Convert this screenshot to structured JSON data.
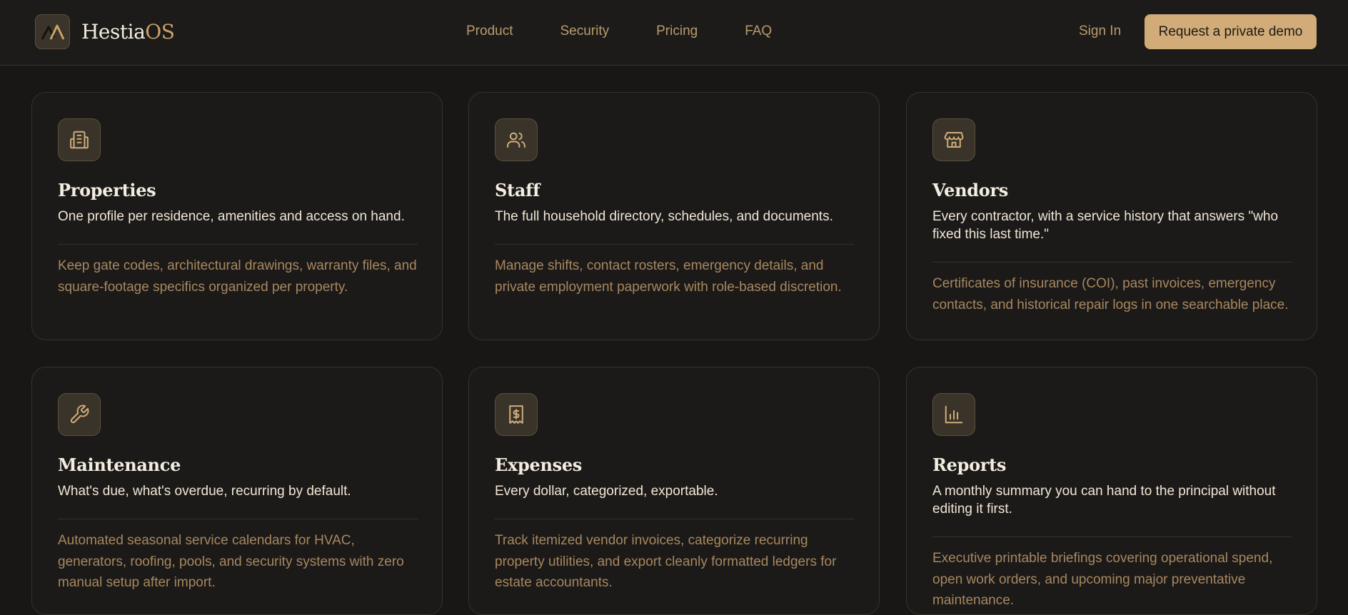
{
  "brand": {
    "name_main": "Hestia",
    "name_accent": "OS",
    "logo_icon": "mountain-logo-icon"
  },
  "nav": {
    "links": [
      "Product",
      "Security",
      "Pricing",
      "FAQ"
    ],
    "sign_in": "Sign In",
    "cta": "Request a private demo"
  },
  "colors": {
    "accent": "#d1ac78",
    "background": "#181716",
    "card_border": "#35322c",
    "muted_text": "#a8875f"
  },
  "cards": [
    {
      "icon": "building-icon",
      "title": "Properties",
      "subtitle": "One profile per residence, amenities and access on hand.",
      "description": "Keep gate codes, architectural drawings, warranty files, and square-footage specifics organized per property."
    },
    {
      "icon": "people-icon",
      "title": "Staff",
      "subtitle": "The full household directory, schedules, and documents.",
      "description": "Manage shifts, contact rosters, emergency details, and private employment paperwork with role-based discretion."
    },
    {
      "icon": "store-icon",
      "title": "Vendors",
      "subtitle": "Every contractor, with a service history that answers \"who fixed this last time.\"",
      "description": "Certificates of insurance (COI), past invoices, emergency contacts, and historical repair logs in one searchable place."
    },
    {
      "icon": "wrench-icon",
      "title": "Maintenance",
      "subtitle": "What's due, what's overdue, recurring by default.",
      "description": "Automated seasonal service calendars for HVAC, generators, roofing, pools, and security systems with zero manual setup after import."
    },
    {
      "icon": "receipt-dollar-icon",
      "title": "Expenses",
      "subtitle": "Every dollar, categorized, exportable.",
      "description": "Track itemized vendor invoices, categorize recurring property utilities, and export cleanly formatted ledgers for estate accountants."
    },
    {
      "icon": "bar-chart-icon",
      "title": "Reports",
      "subtitle": "A monthly summary you can hand to the principal without editing it first.",
      "description": "Executive printable briefings covering operational spend, open work orders, and upcoming major preventative maintenance."
    }
  ]
}
